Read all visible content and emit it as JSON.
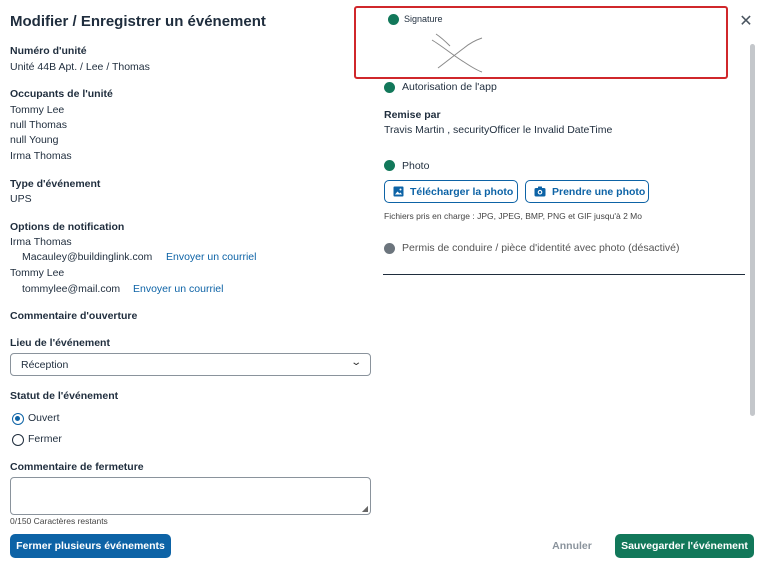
{
  "modal": {
    "title": "Modifier / Enregistrer un événement",
    "close_icon": "close-icon"
  },
  "unit": {
    "label": "Numéro d'unité",
    "value": "Unité 44B Apt. / Lee / Thomas"
  },
  "occupants": {
    "label": "Occupants de l'unité",
    "names": [
      "Tommy Lee",
      "null Thomas",
      "null Young",
      "Irma Thomas"
    ]
  },
  "event_type": {
    "label": "Type d'événement",
    "value": "UPS"
  },
  "notifications": {
    "label": "Options de notification",
    "recipients": [
      {
        "name": "Irma Thomas",
        "email": "Macauley@buildinglink.com",
        "action": "Envoyer un courriel"
      },
      {
        "name": "Tommy Lee",
        "email": "tommylee@mail.com",
        "action": "Envoyer un courriel"
      }
    ]
  },
  "opening_comment": {
    "label": "Commentaire d'ouverture"
  },
  "location": {
    "label": "Lieu de l'événement",
    "selected": "Réception",
    "icon": "chevron-down-icon"
  },
  "status": {
    "label": "Statut de l'événement",
    "options": [
      {
        "label": "Ouvert",
        "checked": true
      },
      {
        "label": "Fermer",
        "checked": false
      }
    ]
  },
  "closing_comment": {
    "label": "Commentaire de fermeture",
    "value": "",
    "counter": "0/150 Caractères restants"
  },
  "signature": {
    "label": "Signature",
    "status_color": "#12785a"
  },
  "app_auth": {
    "label": "Autorisation de l'app",
    "status_color": "#12785a"
  },
  "remise": {
    "label": "Remise par",
    "value": "Travis Martin , securityOfficer le Invalid DateTime"
  },
  "photo": {
    "label": "Photo",
    "status_color": "#12785a",
    "upload_label": "Télécharger la photo",
    "upload_icon": "image-icon",
    "take_label": "Prendre une photo",
    "take_icon": "camera-icon",
    "hint": "Fichiers pris en charge : JPG, JPEG, BMP, PNG et GIF jusqu'à 2 Mo"
  },
  "license": {
    "label": "Permis de conduire / pièce d'identité avec photo (désactivé)",
    "status_color": "#6c757d"
  },
  "footer": {
    "close_multiple": "Fermer plusieurs événements",
    "cancel": "Annuler",
    "save": "Sauvegarder l'événement"
  },
  "colors": {
    "primary": "#0d63a6",
    "success": "#12785a",
    "highlight": "#d0272b"
  }
}
